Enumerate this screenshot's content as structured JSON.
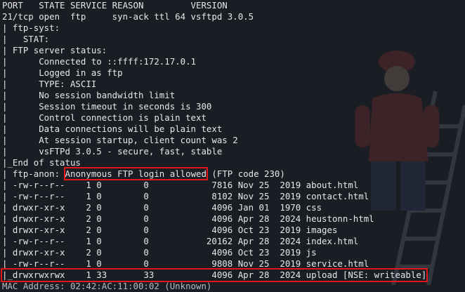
{
  "terminal": {
    "lines": [
      "PORT   STATE SERVICE REASON         VERSION",
      "21/tcp open  ftp     syn-ack ttl 64 vsftpd 3.0.5",
      "| ftp-syst: ",
      "|   STAT: ",
      "| FTP server status:",
      "|      Connected to ::ffff:172.17.0.1",
      "|      Logged in as ftp",
      "|      TYPE: ASCII",
      "|      No session bandwidth limit",
      "|      Session timeout in seconds is 300",
      "|      Control connection is plain text",
      "|      Data connections will be plain text",
      "|      At session startup, client count was 2",
      "|      vsFTPd 3.0.5 - secure, fast, stable",
      "|_End of status",
      "| ftp-anon: ",
      "| -rw-r--r--    1 0        0            7816 Nov 25  2019 about.html",
      "| -rw-r--r--    1 0        0            8102 Nov 25  2019 contact.html",
      "| drwxr-xr-x    2 0        0            4096 Jan 01  1970 css",
      "| drwxr-xr-x    2 0        0            4096 Apr 28  2024 heustonn-html",
      "| drwxr-xr-x    2 0        0            4096 Oct 23  2019 images",
      "| -rw-r--r--    1 0        0           20162 Apr 28  2024 index.html",
      "| drwxr-xr-x    2 0        0            4096 Oct 23  2019 js",
      "| -rw-r--r--    1 0        0            9808 Nov 25  2019 service.html",
      "|_drwxrwxrwx    1 33       33           4096 Apr 28  2024 upload [NSE: writeable]",
      "MAC Address: 02:42:AC:11:00:02 (Unknown)"
    ],
    "anon_highlight": "Anonymous FTP login allowed",
    "anon_suffix": " (FTP code 230)"
  },
  "colors": {
    "background": "#1b1d24",
    "text": "#e7e7ea",
    "highlight_box": "#e01818"
  }
}
